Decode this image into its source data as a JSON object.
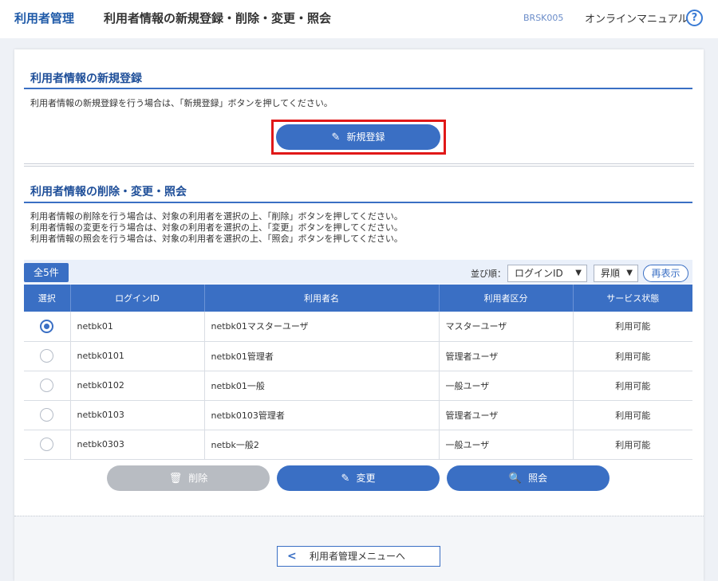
{
  "header": {
    "app_title": "利用者管理",
    "page_title": "利用者情報の新規登録・削除・変更・照会",
    "screen_id": "BRSK005",
    "manual_link": "オンラインマニュアル",
    "help_glyph": "?"
  },
  "register_section": {
    "title": "利用者情報の新規登録",
    "description": "利用者情報の新規登録を行う場合は、「新規登録」ボタンを押してください。",
    "button_label": "新規登録",
    "button_icon": "pencil-icon"
  },
  "manage_section": {
    "title": "利用者情報の削除・変更・照会",
    "description_lines": [
      "利用者情報の削除を行う場合は、対象の利用者を選択の上、「削除」ボタンを押してください。",
      "利用者情報の変更を行う場合は、対象の利用者を選択の上、「変更」ボタンを押してください。",
      "利用者情報の照会を行う場合は、対象の利用者を選択の上、「照会」ボタンを押してください。"
    ]
  },
  "table_controls": {
    "count_label": "全5件",
    "sort_label": "並び順：",
    "sort_field": "ログインID",
    "sort_order": "昇順",
    "redisplay_label": "再表示"
  },
  "table": {
    "columns": [
      "選択",
      "ログインID",
      "利用者名",
      "利用者区分",
      "サービス状態"
    ],
    "rows": [
      {
        "selected": true,
        "login_id": "netbk01",
        "name": "netbk01マスターユーザ",
        "type": "マスターユーザ",
        "status": "利用可能"
      },
      {
        "selected": false,
        "login_id": "netbk0101",
        "name": "netbk01管理者",
        "type": "管理者ユーザ",
        "status": "利用可能"
      },
      {
        "selected": false,
        "login_id": "netbk0102",
        "name": "netbk01一般",
        "type": "一般ユーザ",
        "status": "利用可能"
      },
      {
        "selected": false,
        "login_id": "netbk0103",
        "name": "netbk0103管理者",
        "type": "管理者ユーザ",
        "status": "利用可能"
      },
      {
        "selected": false,
        "login_id": "netbk0303",
        "name": "netbk一般2",
        "type": "一般ユーザ",
        "status": "利用可能"
      }
    ]
  },
  "actions": {
    "delete_label": "削除",
    "change_label": "変更",
    "inquiry_label": "照会"
  },
  "footer": {
    "back_label": "利用者管理メニューへ"
  },
  "colors": {
    "accent": "#3a6fc4",
    "highlight": "#e01818",
    "disabled": "#b8bcc2"
  }
}
